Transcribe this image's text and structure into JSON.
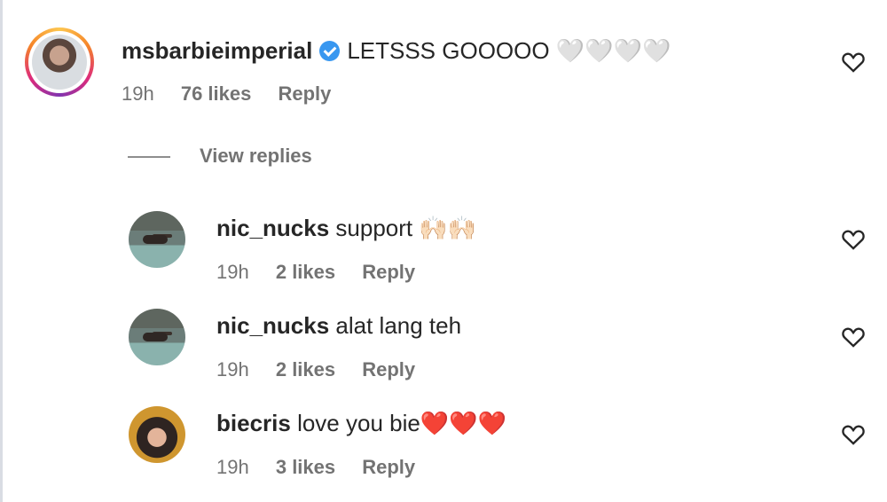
{
  "comments": [
    {
      "username": "msbarbieimperial",
      "verified": true,
      "text": "LETSSS GOOOOO",
      "emoji": "🤍🤍🤍🤍",
      "time": "19h",
      "likes": "76 likes",
      "reply": "Reply"
    }
  ],
  "view_replies": "View replies",
  "replies": [
    {
      "username": "nic_nucks",
      "text": "support",
      "emoji": "🙌🏻🙌🏻",
      "time": "19h",
      "likes": "2 likes",
      "reply": "Reply"
    },
    {
      "username": "nic_nucks",
      "text": "alat lang teh",
      "emoji": "",
      "time": "19h",
      "likes": "2 likes",
      "reply": "Reply"
    },
    {
      "username": "biecris",
      "text": "love you bie",
      "emoji": "❤️❤️❤️",
      "time": "19h",
      "likes": "3 likes",
      "reply": "Reply"
    }
  ],
  "icons": {
    "like": "heart-outline-icon",
    "verified": "verified-badge-icon"
  },
  "colors": {
    "text": "#262626",
    "muted": "#737373",
    "verified": "#3897f0"
  }
}
